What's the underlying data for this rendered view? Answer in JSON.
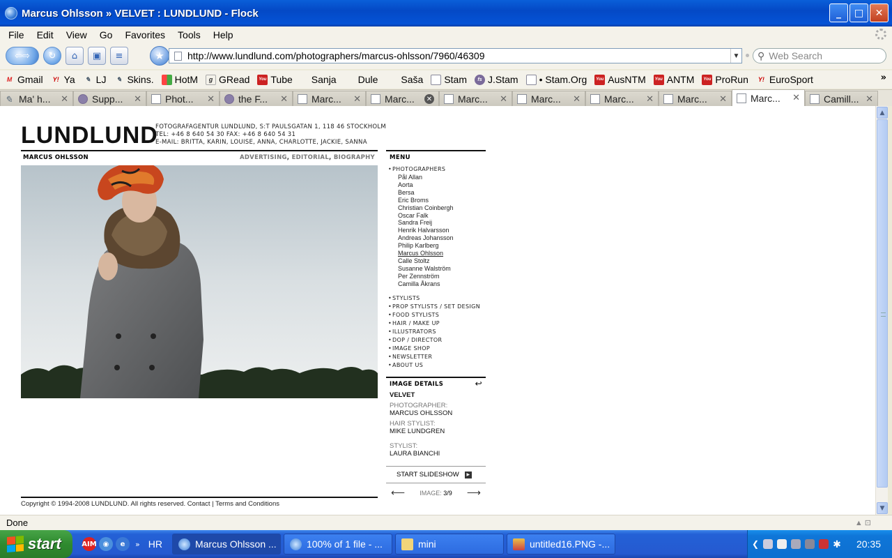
{
  "window": {
    "title": "Marcus Ohlsson » VELVET : LUNDLUND - Flock"
  },
  "menubar": [
    "File",
    "Edit",
    "View",
    "Go",
    "Favorites",
    "Tools",
    "Help"
  ],
  "url": "http://www.lundlund.com/photographers/marcus-ohlsson/7960/46309",
  "search_placeholder": "Web Search",
  "bookmarks": [
    "Gmail",
    "Ya",
    "LJ",
    "Skins.",
    "HotM",
    "GRead",
    "Tube",
    "Sanja",
    "Dule",
    "Saša",
    "Stam",
    "J.Stam",
    "• Stam.Org",
    "AusNTM",
    "ANTM",
    "ProRun",
    "EuroSport"
  ],
  "tabs": [
    "Ma' h...",
    "Supp...",
    "Phot...",
    "the F...",
    "Marc...",
    "Marc...",
    "Marc...",
    "Marc...",
    "Marc...",
    "Marc...",
    "Marc...",
    "Camill..."
  ],
  "page": {
    "logo": "LUNDLUND",
    "address_lines": [
      "FOTOGRAFAGENTUR LUNDLUND, S:T PAULSGATAN 1, 118 46 STOCKHOLM",
      "TEL: +46 8 640 54 30  FAX: +46 8 640 54 31",
      "E-MAIL: BRITTA, KARIN, LOUISE, ANNA, CHARLOTTE, JACKIE, SANNA"
    ],
    "photographer_name": "MARCUS OHLSSON",
    "section_links": [
      "ADVERTISING",
      ",",
      "EDITORIAL",
      ",",
      "BIOGRAPHY"
    ],
    "menu_title": "MENU",
    "menu_photographers": "PHOTOGRAPHERS",
    "photographers": [
      "Pål Allan",
      "Aorta",
      "Bersa",
      "Eric Broms",
      "Christian Coinbergh",
      "Oscar Falk",
      "Sandra Freij",
      "Henrik Halvarsson",
      "Andreas Johansson",
      "Philip Karlberg",
      "Marcus Ohlsson",
      "Calle Stoltz",
      "Susanne Walström",
      "Per Zennström",
      "Camilla Åkrans"
    ],
    "menu_categories": [
      "STYLISTS",
      "PROP STYLISTS / SET DESIGN",
      "FOOD STYLISTS",
      "HAIR / MAKE UP",
      "ILLUSTRATORS",
      "DOP / DIRECTOR",
      "IMAGE SHOP",
      "NEWSLETTER",
      "ABOUT US"
    ],
    "details_title": "IMAGE DETAILS",
    "image_title": "VELVET",
    "photographer_label": "PHOTOGRAPHER:",
    "photographer_value": "MARCUS OHLSSON",
    "hair_label": "HAIR STYLIST:",
    "hair_value": "MIKE LUNDGREN",
    "stylist_label": "STYLIST:",
    "stylist_value": "LAURA BIANCHI",
    "slideshow": "START SLIDESHOW",
    "image_label": "IMAGE:",
    "image_counter": "3/9",
    "copyright": "Copyright © 1994-2008 LUNDLUND. All rights reserved. Contact | Terms and Conditions"
  },
  "status": "Done",
  "taskbar": {
    "start": "start",
    "hr": "HR",
    "buttons": [
      "Marcus Ohlsson ...",
      "100% of 1 file - ...",
      "mini",
      "untitled16.PNG -..."
    ],
    "clock": "20:35"
  }
}
